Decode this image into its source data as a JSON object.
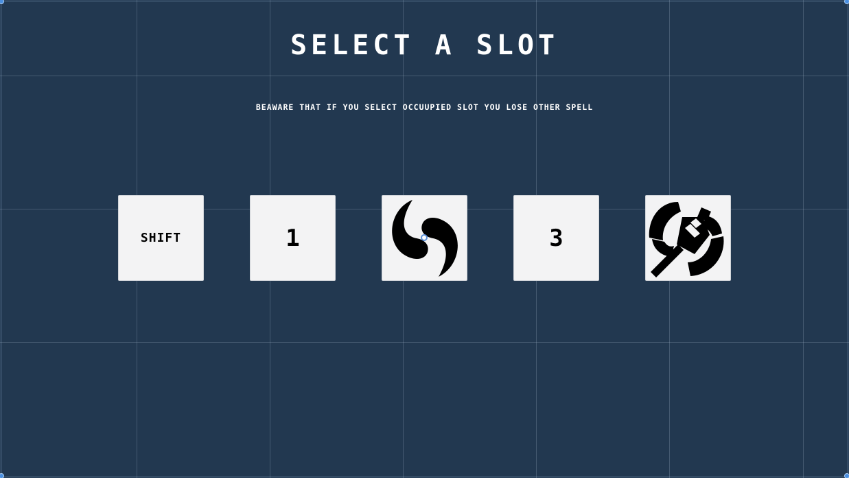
{
  "screen": {
    "title": "Select a slot",
    "warning": "Beaware that if you select occuupied slot you lose other spell"
  },
  "slots": [
    {
      "label": "SHIFT",
      "icon": null
    },
    {
      "label": "1",
      "icon": null
    },
    {
      "label": "",
      "icon": "swirl-icon"
    },
    {
      "label": "3",
      "icon": null
    },
    {
      "label": "",
      "icon": "battle-axe-icon"
    }
  ],
  "colors": {
    "background": "#223850",
    "slot_background": "#f3f3f4",
    "text": "#ffffff",
    "icon": "#000000",
    "editor_handle": "#4a8fe0"
  }
}
